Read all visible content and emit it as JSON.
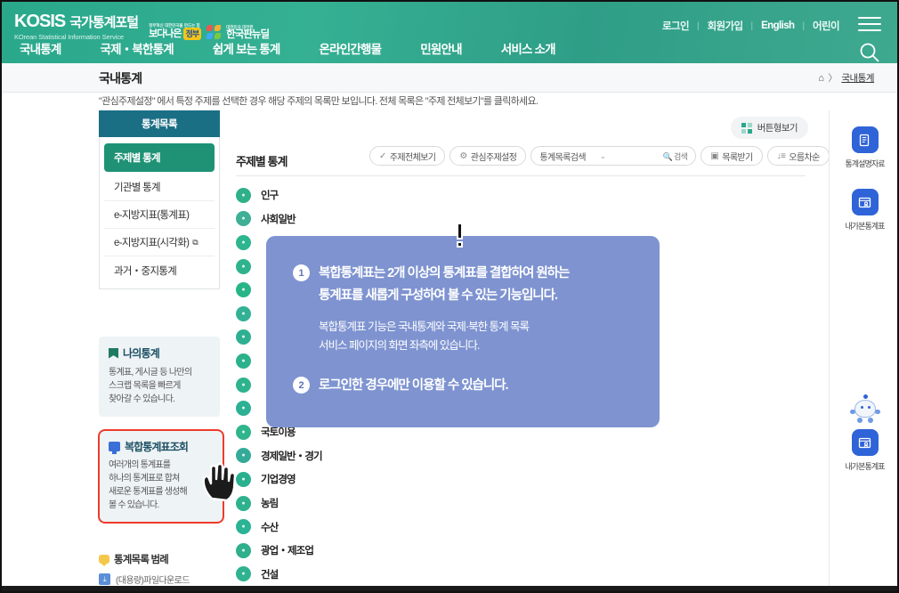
{
  "header": {
    "logo_main": "KOSIS",
    "logo_kr": "국가통계포털",
    "logo_sub": "KOrean Statistical Information Service",
    "gov_tiny1": "정부혁신 대한민국을 만드는 힘",
    "gov_text1": "보다나은",
    "gov_badge": "정부",
    "gov_tiny2": "대한민국 대전환",
    "gov_text2": "한국판뉴딜",
    "util": [
      {
        "label": "로그인"
      },
      {
        "label": "회원가입"
      },
      {
        "label": "English"
      },
      {
        "label": "어린이"
      }
    ],
    "gnb": [
      {
        "label": "국내통계"
      },
      {
        "label": "국제・북한통계"
      },
      {
        "label": "쉽게 보는 통계"
      },
      {
        "label": "온라인간행물"
      },
      {
        "label": "민원안내"
      },
      {
        "label": "서비스 소개"
      }
    ],
    "menu_icon": "hamburger-icon",
    "search_icon": "search-icon"
  },
  "page": {
    "title": "국내통계",
    "breadcrumb_home": "⌂",
    "breadcrumb_sep": "〉",
    "breadcrumb_current": "국내통계",
    "notice": "\"관심주제설정\" 에서 특정 주제를 선택한 경우 해당 주제의 목록만 보입니다. 전체 목록은 \"주제 전체보기\"를 클릭하세요."
  },
  "sidebar": {
    "head": "통계목록",
    "items": [
      {
        "label": "주제별 통계",
        "active": true,
        "external": false
      },
      {
        "label": "기관별 통계",
        "active": false,
        "external": false
      },
      {
        "label": "e-지방지표(통계표)",
        "active": false,
        "external": false
      },
      {
        "label": "e-지방지표(시각화)",
        "active": false,
        "external": true
      },
      {
        "label": "과거・중지통계",
        "active": false,
        "external": false
      }
    ],
    "my_stats": {
      "title": "나의통계",
      "icon": "flag-icon",
      "lines": [
        "통계표, 게시글 등 나만의",
        "스크랩 목록을 빠르게",
        "찾아갈 수 있습니다."
      ]
    },
    "complex_stats": {
      "title": "복합통계표조회",
      "icon": "monitor-icon",
      "lines": [
        "여러개의 통계표를",
        "하나의 통계표로 합쳐",
        "새로운 통계표를 생성해",
        "볼 수 있습니다."
      ]
    },
    "legend": {
      "title": "통계목록 범례",
      "icon": "speech-bubble-icon",
      "rows": [
        {
          "icon": "download-icon",
          "label": "(대용량)파일다운로드"
        }
      ]
    }
  },
  "main": {
    "view_mode_button": "버튼형보기",
    "view_mode_icon": "grid-icon",
    "section_title": "주제별 통계",
    "toolbar": [
      {
        "name": "show-all-topics",
        "icon": "check-icon",
        "label": "주제전체보기"
      },
      {
        "name": "topic-settings",
        "icon": "gear-icon",
        "label": "관심주제설정"
      },
      {
        "name": "list-search-select",
        "icon": "chevron-down-icon",
        "label": "통계목록검색",
        "search_label": "검색",
        "search_icon": "magnifier-icon"
      },
      {
        "name": "receive-list",
        "icon": "inbox-icon",
        "label": "목록받기"
      },
      {
        "name": "sort-ascending",
        "icon": "sort-icon",
        "label": "오름차순"
      }
    ],
    "categories": [
      {
        "label": "인구",
        "icon": "people-icon",
        "color": "#2fb089"
      },
      {
        "label": "사회일반",
        "icon": "society-icon",
        "color": "#3faf95"
      },
      {
        "label": "",
        "icon": "hidden-icon-3",
        "color": "#2db58f"
      },
      {
        "label": "",
        "icon": "hidden-icon-4",
        "color": "#2eb38d"
      },
      {
        "label": "",
        "icon": "hidden-icon-5",
        "color": "#28b487"
      },
      {
        "label": "",
        "icon": "hidden-icon-6",
        "color": "#32b194"
      },
      {
        "label": "",
        "icon": "hidden-icon-7",
        "color": "#2faf91"
      },
      {
        "label": "",
        "icon": "hidden-icon-8",
        "color": "#2bb18c"
      },
      {
        "label": "",
        "icon": "hidden-icon-9",
        "color": "#2fb38f"
      },
      {
        "label": "",
        "icon": "hidden-icon-10",
        "color": "#2db093"
      },
      {
        "label": "국토이용",
        "icon": "land-icon",
        "color": "#2fb58c"
      },
      {
        "label": "경제일반・경기",
        "icon": "economy-icon",
        "color": "#33ab98"
      },
      {
        "label": "기업경영",
        "icon": "business-icon",
        "color": "#2ab08f"
      },
      {
        "label": "농림",
        "icon": "agriculture-icon",
        "color": "#2eb28d"
      },
      {
        "label": "수산",
        "icon": "fishery-icon",
        "color": "#2bb396"
      },
      {
        "label": "광업・제조업",
        "icon": "mining-icon",
        "color": "#2faf8c"
      },
      {
        "label": "건설",
        "icon": "construction-icon",
        "color": "#2fb28f"
      }
    ],
    "popup": {
      "marker_icon": "exclamation-icon",
      "items": [
        {
          "num": "1",
          "lines": [
            "복합통계표는 2개 이상의 통계표를 결합하여 원하는",
            "통계표를 새롭게 구성하여 볼 수 있는 기능입니다."
          ],
          "sub_lines": [
            "복합통계표 기능은 국내통계와 국제·북한 통계 목록",
            "서비스 페이지의 화면 좌측에 있습니다."
          ]
        },
        {
          "num": "2",
          "lines": [
            "로그인한 경우에만 이용할 수 있습니다."
          ],
          "sub_lines": []
        }
      ]
    }
  },
  "rail": {
    "items": [
      {
        "label": "통계설명자료",
        "icon": "document-icon",
        "mascot": false
      },
      {
        "label": "내가본통계표",
        "icon": "viewed-table-icon",
        "mascot": false
      },
      {
        "label": "내가본통계표",
        "icon": "viewed-table-icon",
        "mascot": true
      }
    ]
  },
  "colors": {
    "header_green": "#2fa98d",
    "lnb_head": "#1b6f85",
    "lnb_active": "#1f9276",
    "popup_purple": "#7e93d0",
    "highlight_red": "#ef3b2c",
    "rail_blue": "#2f63d8"
  }
}
